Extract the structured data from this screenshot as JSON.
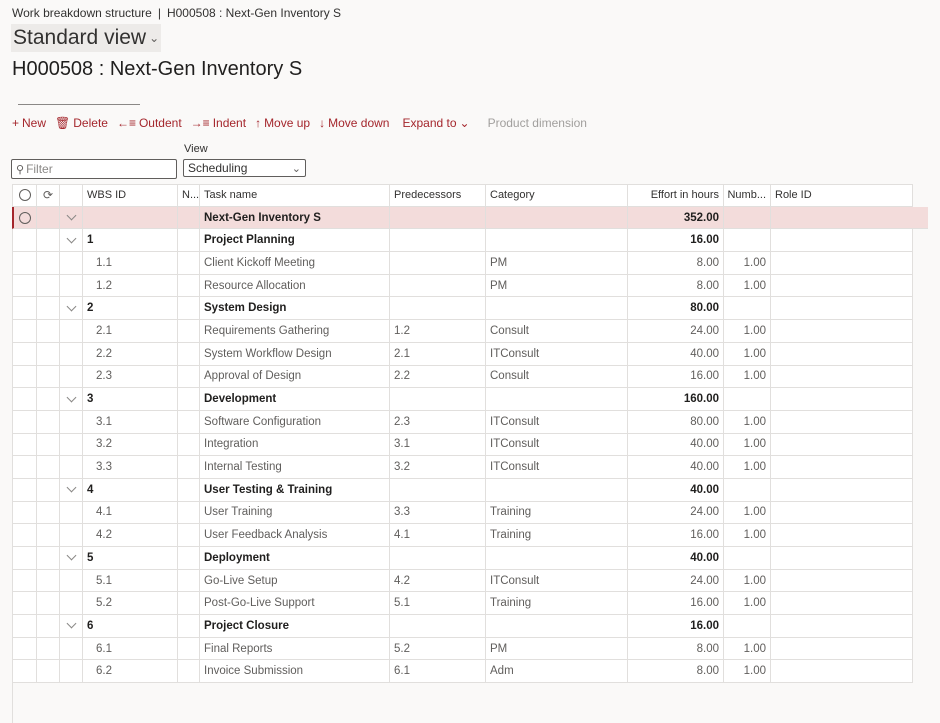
{
  "breadcrumb": {
    "items": [
      "Work breakdown structure",
      "H000508 : Next-Gen Inventory S"
    ],
    "separator": "|"
  },
  "view_selector": {
    "label": "Standard view"
  },
  "page_title": "H000508 : Next-Gen Inventory S",
  "toolbar": {
    "new": "New",
    "delete": "Delete",
    "outdent": "Outdent",
    "indent": "Indent",
    "move_up": "Move up",
    "move_down": "Move down",
    "expand_to": "Expand to",
    "product_dimension": "Product dimension"
  },
  "filter": {
    "placeholder": "Filter",
    "value": ""
  },
  "view": {
    "label": "View",
    "selected": "Scheduling"
  },
  "grid": {
    "headers": {
      "wbs_id": "WBS ID",
      "n": "N...",
      "task_name": "Task name",
      "predecessors": "Predecessors",
      "category": "Category",
      "effort": "Effort in hours",
      "number": "Numb...",
      "role_id": "Role ID"
    },
    "rows": [
      {
        "level": 0,
        "wbs": "",
        "task": "Next-Gen Inventory S",
        "pred": "",
        "cat": "",
        "effort": "352.00",
        "num": "",
        "role": "",
        "selected": true
      },
      {
        "level": 1,
        "wbs": "1",
        "task": "Project Planning",
        "pred": "",
        "cat": "",
        "effort": "16.00",
        "num": "",
        "role": ""
      },
      {
        "level": 2,
        "wbs": "1.1",
        "task": "Client Kickoff Meeting",
        "pred": "",
        "cat": "PM",
        "effort": "8.00",
        "num": "1.00",
        "role": ""
      },
      {
        "level": 2,
        "wbs": "1.2",
        "task": "Resource Allocation",
        "pred": "",
        "cat": "PM",
        "effort": "8.00",
        "num": "1.00",
        "role": ""
      },
      {
        "level": 1,
        "wbs": "2",
        "task": "System Design",
        "pred": "",
        "cat": "",
        "effort": "80.00",
        "num": "",
        "role": ""
      },
      {
        "level": 2,
        "wbs": "2.1",
        "task": "Requirements Gathering",
        "pred": "1.2",
        "cat": "Consult",
        "effort": "24.00",
        "num": "1.00",
        "role": ""
      },
      {
        "level": 2,
        "wbs": "2.2",
        "task": "System Workflow Design",
        "pred": "2.1",
        "cat": "ITConsult",
        "effort": "40.00",
        "num": "1.00",
        "role": ""
      },
      {
        "level": 2,
        "wbs": "2.3",
        "task": "Approval of Design",
        "pred": "2.2",
        "cat": "Consult",
        "effort": "16.00",
        "num": "1.00",
        "role": ""
      },
      {
        "level": 1,
        "wbs": "3",
        "task": "Development",
        "pred": "",
        "cat": "",
        "effort": "160.00",
        "num": "",
        "role": ""
      },
      {
        "level": 2,
        "wbs": "3.1",
        "task": "Software Configuration",
        "pred": "2.3",
        "cat": "ITConsult",
        "effort": "80.00",
        "num": "1.00",
        "role": ""
      },
      {
        "level": 2,
        "wbs": "3.2",
        "task": "Integration",
        "pred": "3.1",
        "cat": "ITConsult",
        "effort": "40.00",
        "num": "1.00",
        "role": ""
      },
      {
        "level": 2,
        "wbs": "3.3",
        "task": "Internal Testing",
        "pred": "3.2",
        "cat": "ITConsult",
        "effort": "40.00",
        "num": "1.00",
        "role": ""
      },
      {
        "level": 1,
        "wbs": "4",
        "task": "User Testing & Training",
        "pred": "",
        "cat": "",
        "effort": "40.00",
        "num": "",
        "role": ""
      },
      {
        "level": 2,
        "wbs": "4.1",
        "task": "User Training",
        "pred": "3.3",
        "cat": "Training",
        "effort": "24.00",
        "num": "1.00",
        "role": ""
      },
      {
        "level": 2,
        "wbs": "4.2",
        "task": "User Feedback Analysis",
        "pred": "4.1",
        "cat": "Training",
        "effort": "16.00",
        "num": "1.00",
        "role": ""
      },
      {
        "level": 1,
        "wbs": "5",
        "task": "Deployment",
        "pred": "",
        "cat": "",
        "effort": "40.00",
        "num": "",
        "role": ""
      },
      {
        "level": 2,
        "wbs": "5.1",
        "task": "Go-Live Setup",
        "pred": "4.2",
        "cat": "ITConsult",
        "effort": "24.00",
        "num": "1.00",
        "role": ""
      },
      {
        "level": 2,
        "wbs": "5.2",
        "task": "Post-Go-Live Support",
        "pred": "5.1",
        "cat": "Training",
        "effort": "16.00",
        "num": "1.00",
        "role": ""
      },
      {
        "level": 1,
        "wbs": "6",
        "task": "Project Closure",
        "pred": "",
        "cat": "",
        "effort": "16.00",
        "num": "",
        "role": ""
      },
      {
        "level": 2,
        "wbs": "6.1",
        "task": "Final Reports",
        "pred": "5.2",
        "cat": "PM",
        "effort": "8.00",
        "num": "1.00",
        "role": ""
      },
      {
        "level": 2,
        "wbs": "6.2",
        "task": "Invoice Submission",
        "pred": "6.1",
        "cat": "Adm",
        "effort": "8.00",
        "num": "1.00",
        "role": ""
      }
    ]
  },
  "colors": {
    "accent": "#a4262c",
    "selected_row": "#f3dcdb",
    "disabled": "#a19f9d"
  }
}
